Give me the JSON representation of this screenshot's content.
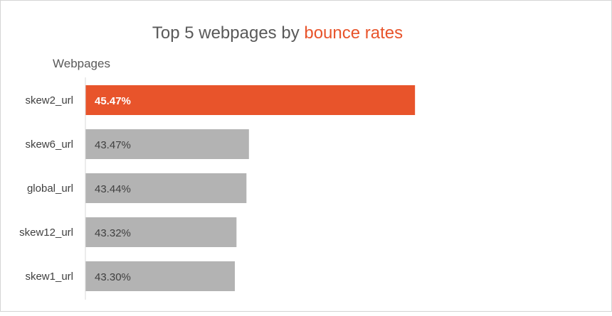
{
  "chart_data": {
    "type": "bar",
    "orientation": "horizontal",
    "title": {
      "prefix": "Top 5 webpages by ",
      "highlight": "bounce rates"
    },
    "ylabel": "Webpages",
    "categories": [
      "skew2_url",
      "skew6_url",
      "global_url",
      "skew12_url",
      "skew1_url"
    ],
    "values": [
      45.47,
      43.47,
      43.44,
      43.32,
      43.3
    ],
    "value_labels": [
      "45.47%",
      "43.47%",
      "43.44%",
      "43.32%",
      "43.30%"
    ],
    "xlim": [
      41.5,
      47.5
    ],
    "grid": false,
    "colors": {
      "highlight": "#e8542b",
      "default": "#b3b3b3",
      "highlight_text": "#ffffff",
      "default_text": "#404040",
      "axis": "#d9d9d9"
    },
    "highlight_index": 0
  }
}
